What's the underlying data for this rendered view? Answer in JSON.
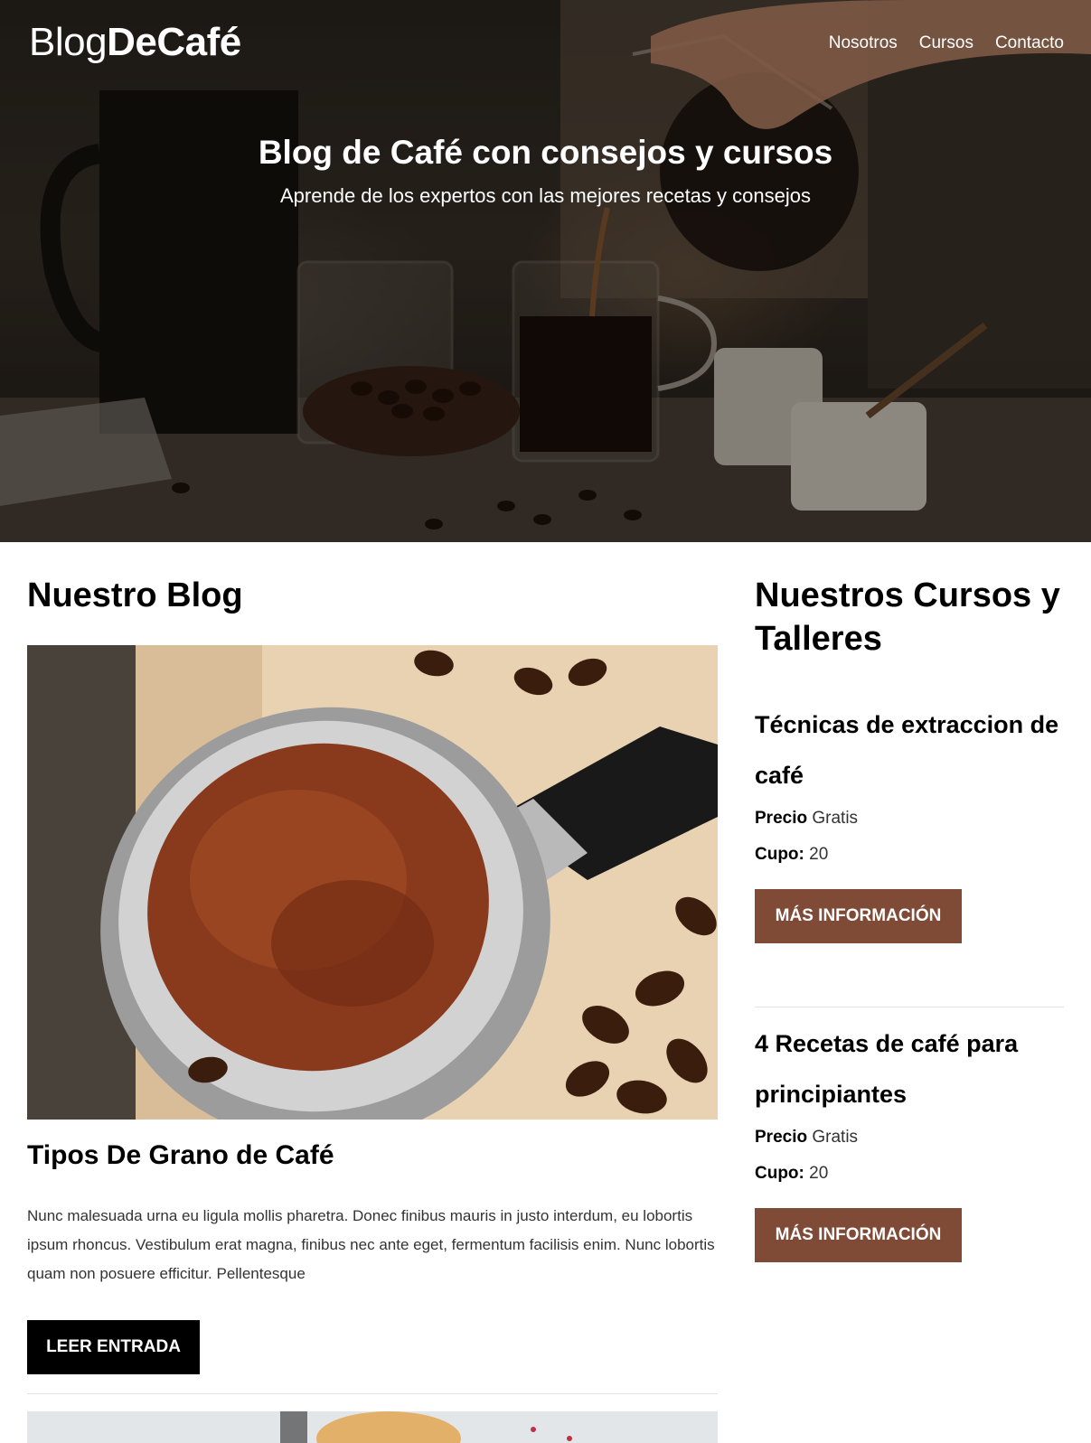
{
  "header": {
    "logo_light": "Blog",
    "logo_bold": "DeCafé",
    "nav": [
      "Nosotros",
      "Cursos",
      "Contacto"
    ]
  },
  "hero": {
    "title": "Blog de Café con consejos y cursos",
    "subtitle": "Aprende de los expertos con las mejores recetas y consejos"
  },
  "blog": {
    "section_title": "Nuestro Blog",
    "posts": [
      {
        "title": "Tipos De Grano de Café",
        "excerpt": "Nunc malesuada urna eu ligula mollis pharetra. Donec finibus mauris in justo interdum, eu lobortis ipsum rhoncus. Vestibulum erat magna, finibus nec ante eget, fermentum facilisis enim. Nunc lobortis quam non posuere efficitur. Pellentesque",
        "button": "Leer Entrada"
      }
    ]
  },
  "courses": {
    "section_title": "Nuestros Cursos y Talleres",
    "items": [
      {
        "name": "Técnicas de extraccion de café",
        "price_label": "Precio",
        "price_value": "Gratis",
        "cupo_label": "Cupo:",
        "cupo_value": "20",
        "button": "MÁS INFORMACIÓN"
      },
      {
        "name": "4 Recetas de café para principiantes",
        "price_label": "Precio",
        "price_value": "Gratis",
        "cupo_label": "Cupo:",
        "cupo_value": "20",
        "button": "MÁS INFORMACIÓN"
      }
    ]
  },
  "colors": {
    "brand_brown": "#7f4b36",
    "black": "#000000",
    "white": "#ffffff"
  }
}
